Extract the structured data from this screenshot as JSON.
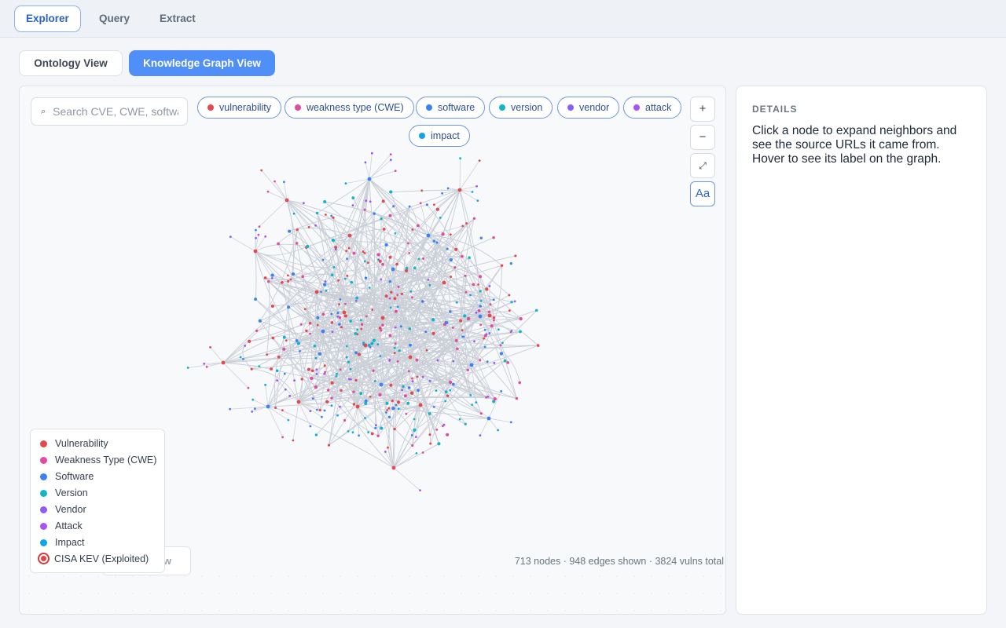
{
  "top_tabs": [
    {
      "label": "Explorer",
      "active": true
    },
    {
      "label": "Query",
      "active": false
    },
    {
      "label": "Extract",
      "active": false
    }
  ],
  "views": {
    "ontology_label": "Ontology View",
    "kg_label": "Knowledge Graph View",
    "active": "Knowledge Graph View"
  },
  "search": {
    "placeholder": "Search CVE, CWE, software…",
    "icon": "search-icon"
  },
  "filter_chips": [
    {
      "label": "vulnerability",
      "color": "#e5484d"
    },
    {
      "label": "weakness type (CWE)",
      "color": "#e34ba0"
    },
    {
      "label": "software",
      "color": "#3b82f6"
    },
    {
      "label": "version",
      "color": "#11b5c9"
    },
    {
      "label": "vendor",
      "color": "#8b5cf6"
    },
    {
      "label": "attack",
      "color": "#a855f7"
    },
    {
      "label": "impact",
      "color": "#0ea5e9"
    }
  ],
  "controls": {
    "zoom_in": "+",
    "zoom_out": "−",
    "fit": "⤢",
    "labels": "Aa"
  },
  "legend": [
    {
      "label": "Vulnerability",
      "color": "#e5484d"
    },
    {
      "label": "Weakness Type (CWE)",
      "color": "#e34ba0"
    },
    {
      "label": "Software",
      "color": "#3b82f6"
    },
    {
      "label": "Version",
      "color": "#11b5c9"
    },
    {
      "label": "Vendor",
      "color": "#8b5cf6"
    },
    {
      "label": "Attack",
      "color": "#a855f7"
    },
    {
      "label": "Impact",
      "color": "#0ea5e9"
    },
    {
      "label": "CISA KEV (Exploited)",
      "color": "#d63a3a"
    }
  ],
  "obscured_button_label": "w",
  "stats": "713 nodes · 948 edges shown · 3824 vulns total",
  "details": {
    "title": "DETAILS",
    "text": "Click a node to expand neighbors and see the source URLs it came from. Hover to see its label on the graph."
  }
}
